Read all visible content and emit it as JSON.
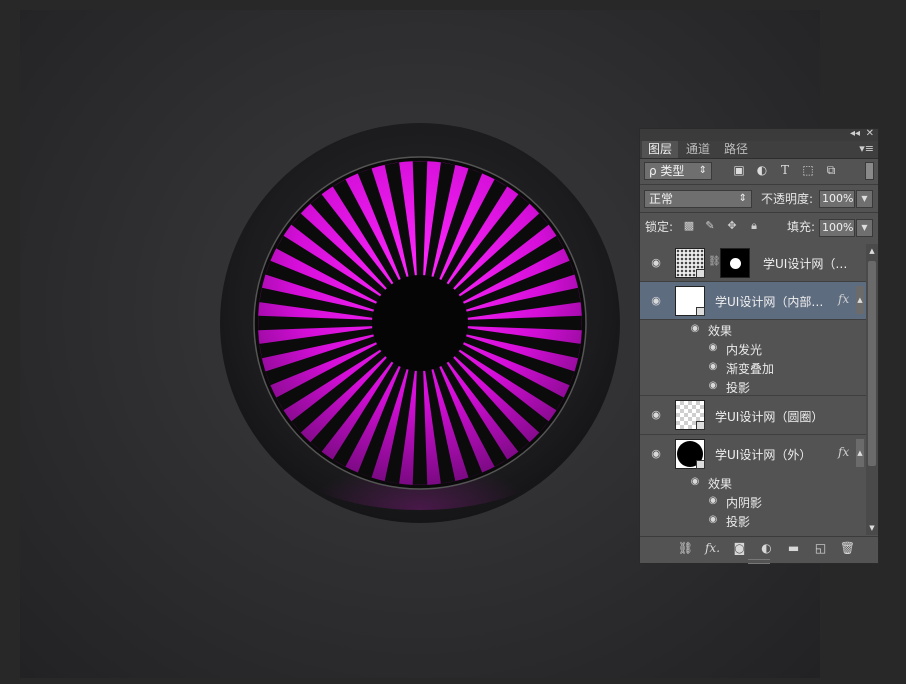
{
  "canvas": {
    "colors": {
      "accent": "#e010e0",
      "ring_outer": "#1e1e20",
      "ring_inner": "#0a0a0a",
      "bg": "#333335"
    },
    "spoke_count": 36
  },
  "panel": {
    "controls": {
      "collapse_icon": "double-chevron-left-icon",
      "collapse": "◂◂",
      "close_icon": "close-icon",
      "close": "✕"
    },
    "tabs": [
      {
        "label": "图层",
        "active": true
      },
      {
        "label": "通道",
        "active": false
      },
      {
        "label": "路径",
        "active": false
      }
    ],
    "menu": "▾≡",
    "filter": {
      "kind_label": "ρ 类型",
      "kind_arrow": "⇕",
      "icons": [
        "image-filter-icon",
        "adjustment-filter-icon",
        "type-filter-icon",
        "shape-filter-icon",
        "smart-object-filter-icon"
      ]
    },
    "blend": {
      "mode": "正常",
      "arrow": "⇕",
      "opacity_label": "不透明度:",
      "opacity": "100%",
      "fill_label": "填充:",
      "fill": "100%"
    },
    "lock": {
      "label": "锁定:",
      "icons": [
        "lock-transparent-icon",
        "lock-image-icon",
        "lock-position-icon",
        "lock-all-icon"
      ]
    },
    "layers": [
      {
        "name": "学UI设计网（…",
        "visible": true,
        "thumb": "noise",
        "mask": true,
        "selected": false,
        "fx": false
      },
      {
        "name": "学UI设计网（内部…",
        "visible": true,
        "thumb": "white",
        "selected": true,
        "fx": true,
        "effects_label": "效果",
        "effects": [
          "内发光",
          "渐变叠加",
          "投影"
        ]
      },
      {
        "name": "学UI设计网（圆圈）",
        "visible": true,
        "thumb": "checker",
        "selected": false,
        "fx": false
      },
      {
        "name": "学UI设计网（外）",
        "visible": true,
        "thumb": "black-circle",
        "selected": false,
        "fx": true,
        "effects_label": "效果",
        "effects": [
          "内阴影",
          "投影"
        ]
      }
    ],
    "fx_label": "fx",
    "bottom_icons": [
      "link-layers-icon",
      "layer-style-fx-icon",
      "add-mask-icon",
      "adjustment-layer-icon",
      "new-group-folder-icon",
      "new-layer-icon",
      "trash-icon"
    ]
  }
}
